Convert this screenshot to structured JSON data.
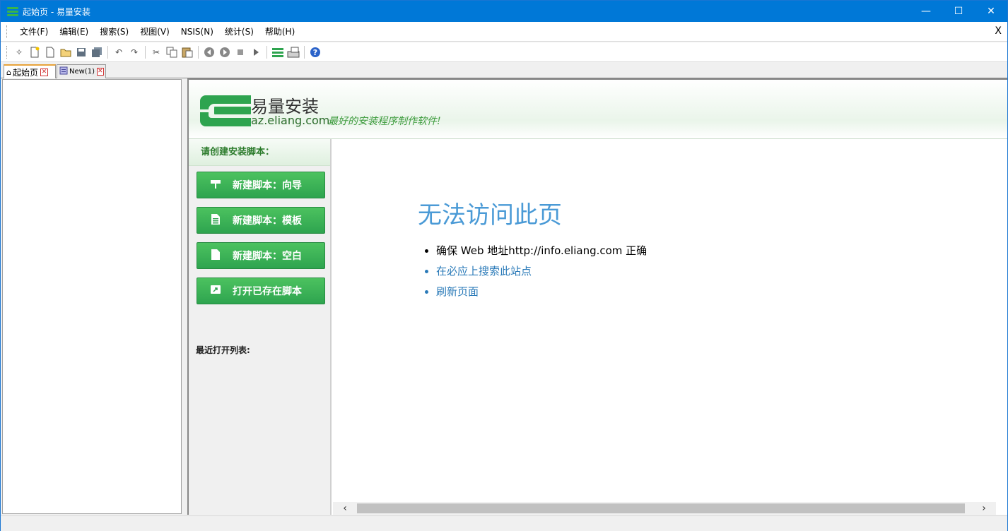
{
  "window": {
    "title": "起始页 - 易量安装",
    "minimize": "—",
    "maximize": "☐",
    "close": "✕"
  },
  "menu": {
    "items": [
      "文件(F)",
      "编辑(E)",
      "搜索(S)",
      "视图(V)",
      "NSIS(N)",
      "统计(S)",
      "帮助(H)"
    ],
    "close": "X"
  },
  "toolbar": {
    "icons": [
      "wand-icon",
      "new-file-icon",
      "blank-file-icon",
      "open-folder-icon",
      "save-icon",
      "save-all-icon",
      "undo-icon",
      "redo-icon",
      "cut-icon",
      "copy-icon",
      "paste-icon",
      "back-icon",
      "forward-icon",
      "stop-icon",
      "run-icon",
      "logo-icon",
      "compile-icon",
      "help-icon"
    ]
  },
  "tabs": [
    {
      "label": "起始页",
      "active": true
    },
    {
      "label": "New(1)",
      "active": false
    }
  ],
  "startpage": {
    "logo_name": "易量安装",
    "logo_url": "az.eliang.com",
    "slogan": "最好的安装程序制作软件!",
    "sidebar_header": "请创建安装脚本：",
    "buttons": [
      {
        "label": "新建脚本：向导",
        "icon": "signpost-icon"
      },
      {
        "label": "新建脚本：模板",
        "icon": "document-lines-icon"
      },
      {
        "label": "新建脚本：空白",
        "icon": "blank-document-icon"
      },
      {
        "label": "打开已存在脚本",
        "icon": "open-script-icon"
      }
    ],
    "recent_label": "最近打开列表:",
    "error": {
      "title": "无法访问此页",
      "items": [
        {
          "text": "确保 Web 地址http://info.eliang.com 正确",
          "link": false
        },
        {
          "text": "在必应上搜索此站点",
          "link": true
        },
        {
          "text": "刷新页面",
          "link": true
        }
      ]
    }
  },
  "colors": {
    "titlebar": "#0078d7",
    "brand_green": "#2ea44f",
    "error_blue": "#4a9ad6",
    "link_blue": "#2a7ab8"
  }
}
